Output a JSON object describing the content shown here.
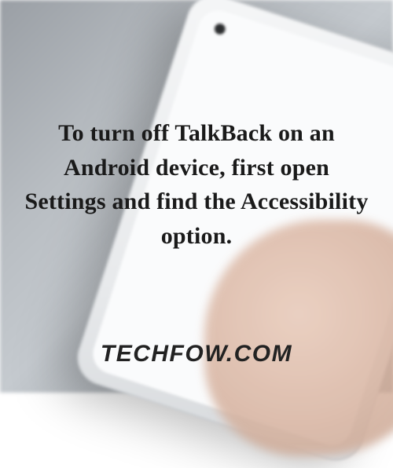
{
  "instruction_text": "To turn off TalkBack on an Android device, first open Settings and find the Accessibility option.",
  "watermark_text": "TECHFOW.COM"
}
